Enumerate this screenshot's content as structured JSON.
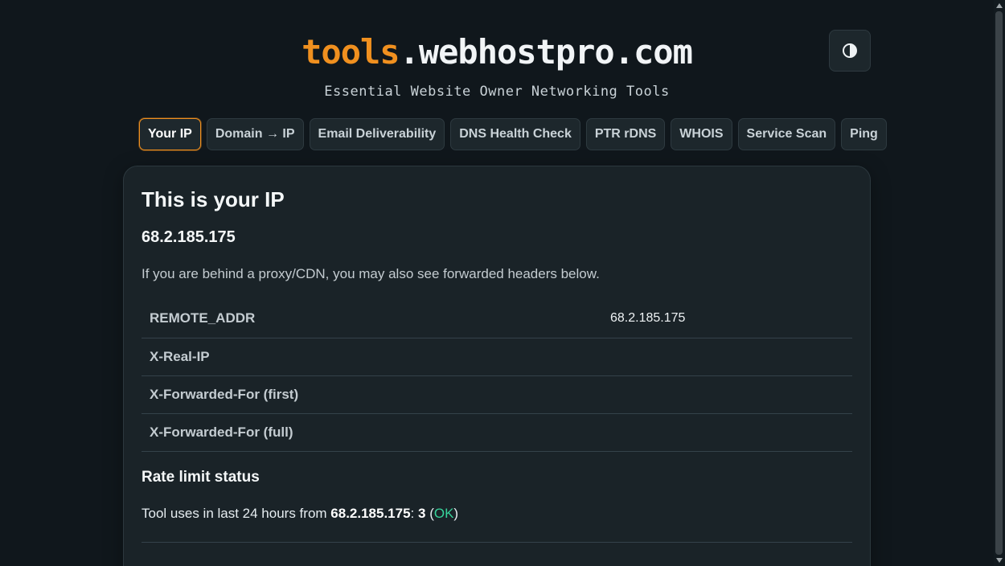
{
  "brand": {
    "accent": "tools",
    "rest": ".webhostpro.com",
    "tagline": "Essential Website Owner Networking Tools"
  },
  "theme_toggle": {
    "icon": "contrast-icon"
  },
  "tabs": [
    {
      "label": "Your IP",
      "active": true
    },
    {
      "label": "Domain → IP",
      "active": false
    },
    {
      "label": "Email Deliverability",
      "active": false
    },
    {
      "label": "DNS Health Check",
      "active": false
    },
    {
      "label": "PTR rDNS",
      "active": false
    },
    {
      "label": "WHOIS",
      "active": false
    },
    {
      "label": "Service Scan",
      "active": false
    },
    {
      "label": "Ping",
      "active": false
    }
  ],
  "main": {
    "title": "This is your IP",
    "ip": "68.2.185.175",
    "note": "If you are behind a proxy/CDN, you may also see forwarded headers below.",
    "headers": [
      {
        "key": "REMOTE_ADDR",
        "value": "68.2.185.175"
      },
      {
        "key": "X-Real-IP",
        "value": ""
      },
      {
        "key": "X-Forwarded-For (first)",
        "value": ""
      },
      {
        "key": "X-Forwarded-For (full)",
        "value": ""
      }
    ],
    "rate": {
      "title": "Rate limit status",
      "prefix": "Tool uses in last 24 hours from ",
      "ip": "68.2.185.175",
      "sep": ": ",
      "count": "3",
      "open": " (",
      "status": "OK",
      "close": ")"
    }
  },
  "colors": {
    "background": "#10171c",
    "accent": "#f0901f",
    "ok": "#37d39b",
    "card": "#1a2328"
  }
}
